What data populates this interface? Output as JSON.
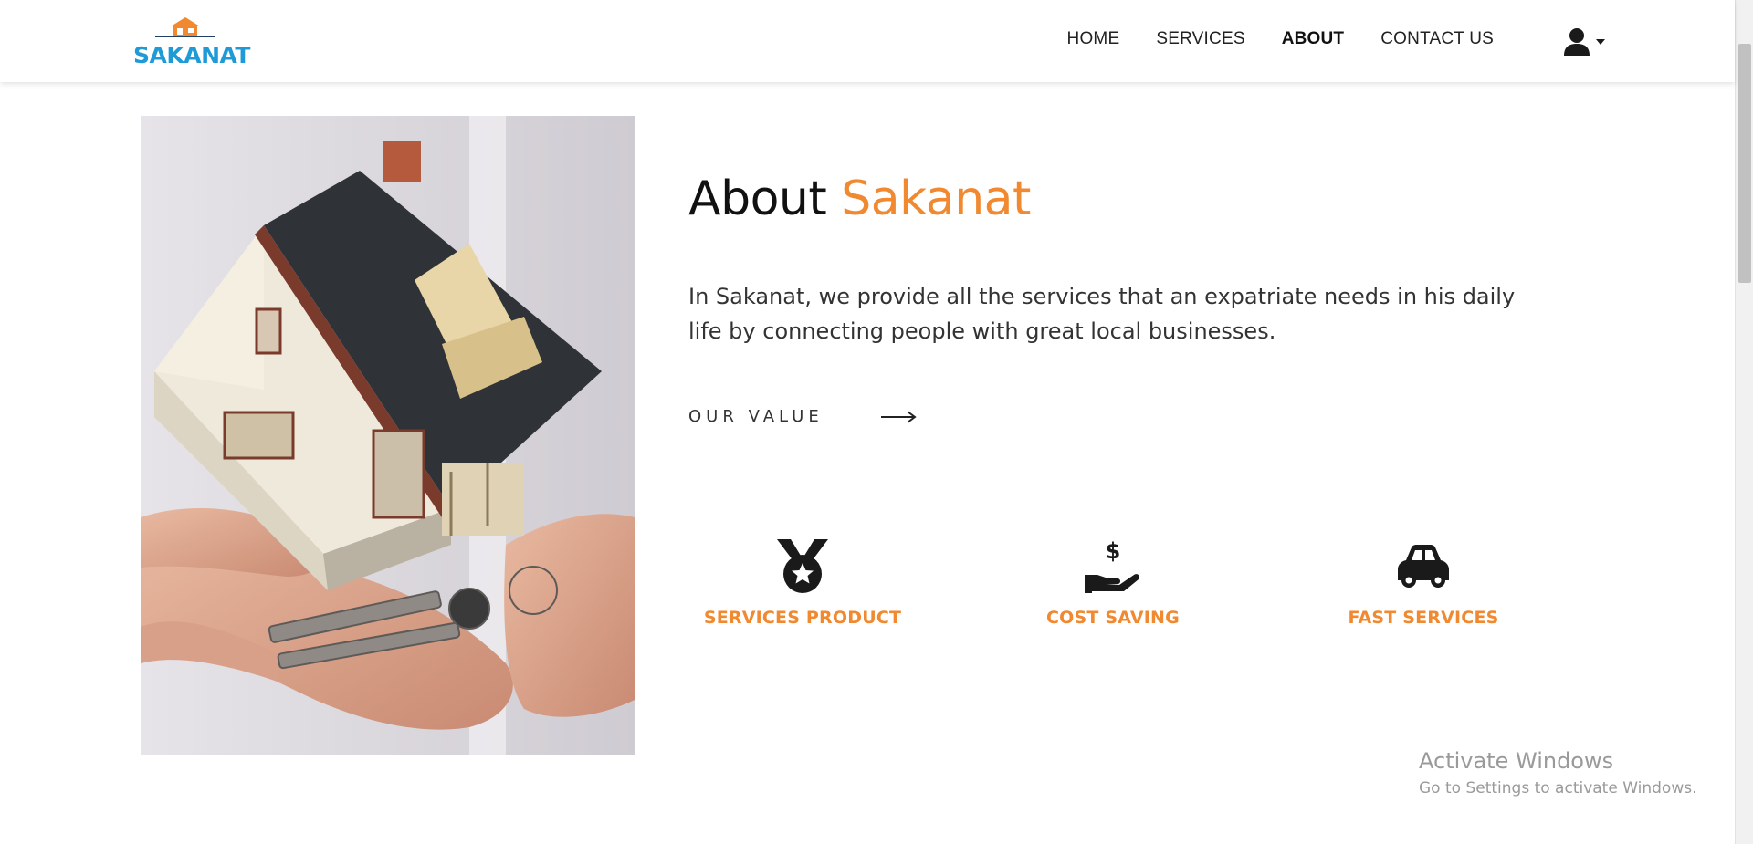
{
  "logo": {
    "text": "SAKANAT"
  },
  "nav": {
    "items": [
      {
        "label": "HOME",
        "active": false
      },
      {
        "label": "SERVICES",
        "active": false
      },
      {
        "label": "ABOUT",
        "active": true
      },
      {
        "label": "CONTACT US",
        "active": false
      }
    ],
    "user_icon": "user-icon",
    "dropdown_icon": "caret-down-icon"
  },
  "about": {
    "title_prefix": "About ",
    "title_accent": "Sakanat",
    "description": "In Sakanat, we provide all the services that an expatriate needs in his daily life by connecting people with great local businesses.",
    "value_link": "OUR VALUE",
    "arrow_icon": "long-arrow-right-icon"
  },
  "features": [
    {
      "label": "SERVICES PRODUCT",
      "icon": "medal-icon"
    },
    {
      "label": "COST SAVING",
      "icon": "hand-holding-dollar-icon"
    },
    {
      "label": "FAST SERVICES",
      "icon": "car-icon"
    }
  ],
  "watermark": {
    "title": "Activate Windows",
    "subtitle": "Go to Settings to activate Windows."
  },
  "colors": {
    "accent": "#f0892f",
    "logo_blue": "#1e9ad6",
    "text_dark": "#111111"
  }
}
